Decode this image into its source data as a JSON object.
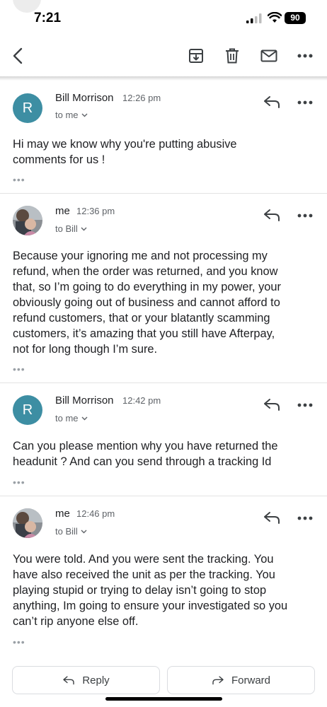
{
  "status_bar": {
    "time": "7:21",
    "battery": "90"
  },
  "toolbar": {
    "icons": [
      "back-arrow-icon",
      "archive-icon",
      "trash-icon",
      "mail-icon",
      "more-icon"
    ]
  },
  "messages": [
    {
      "sender": "Bill Morrison",
      "avatar_letter": "R",
      "avatar_color": "#3d8ea3",
      "time": "12:26 pm",
      "recipient": "to me",
      "body": [
        "Hi may we know why you're putting abusive",
        "comments for us !"
      ]
    },
    {
      "sender": "me",
      "time": "12:36 pm",
      "recipient": "to Bill",
      "body": [
        "Because your ignoring me and not processing my",
        "refund, when the order was returned, and you know",
        "that, so I’m going to do everything in my power, your",
        "obviously going out of business and cannot afford to",
        "refund customers, that or your blatantly scamming",
        "customers, it’s amazing that you still have Afterpay,",
        "not for long though I’m sure."
      ]
    },
    {
      "sender": "Bill Morrison",
      "avatar_letter": "R",
      "avatar_color": "#3d8ea3",
      "time": "12:42 pm",
      "recipient": "to me",
      "body": [
        "Can you please mention why you have returned the",
        "headunit ? And can you send through a tracking Id"
      ]
    },
    {
      "sender": "me",
      "time": "12:46 pm",
      "recipient": "to Bill",
      "body": [
        "You were told. And you were sent the tracking. You",
        "have also received the unit as per the tracking. You",
        "playing stupid or trying to delay isn’t going to stop",
        "anything, Im going to ensure your investigated so you",
        "can’t rip anyone else off."
      ]
    }
  ],
  "actions": {
    "reply_label": "Reply",
    "forward_label": "Forward"
  }
}
